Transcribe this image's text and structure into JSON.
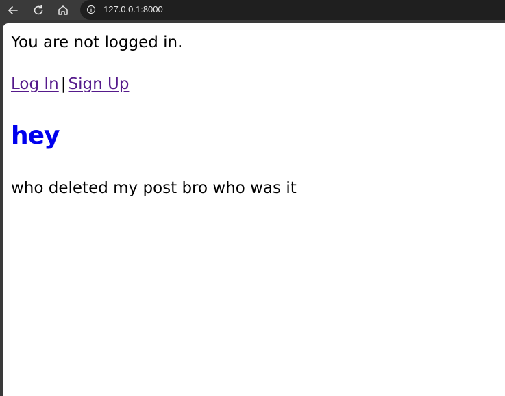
{
  "browser": {
    "url": "127.0.0.1:8000",
    "icons": [
      "back-arrow-icon",
      "reload-icon",
      "home-icon",
      "info-icon"
    ]
  },
  "page": {
    "status_text": "You are not logged in.",
    "login_link": "Log In",
    "separator": "|",
    "signup_link": "Sign Up",
    "post": {
      "title": "hey",
      "body": "who deleted my post bro who was it"
    }
  },
  "colors": {
    "link_visited": "#551a8b",
    "title_link": "#0000ee",
    "chrome_bg": "#3a3a3a",
    "omnibox_bg": "#1f1f1f"
  }
}
